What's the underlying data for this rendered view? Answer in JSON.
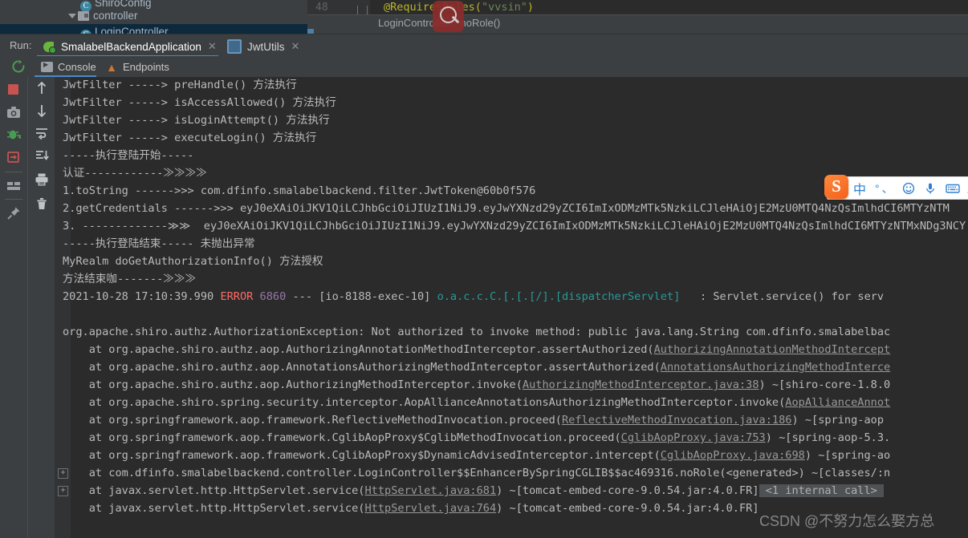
{
  "project_tree": {
    "rows": [
      {
        "label": "ShiroConfig",
        "icon": "class-icon",
        "selected": false
      },
      {
        "label": "controller",
        "icon": "folder-icon",
        "selected": false
      },
      {
        "label": "LoginController",
        "icon": "class-icon",
        "selected": true
      }
    ]
  },
  "editor": {
    "line_number": "48",
    "code_annotation": "@RequiresRoles",
    "code_paren_open": "(",
    "code_string": "\"vvsin\"",
    "code_paren_close": ")",
    "breadcrumb": {
      "class": "LoginController",
      "separator": "›",
      "method": "noRole()"
    }
  },
  "run_window": {
    "label": "Run:",
    "tabs": [
      {
        "label": "SmalabelBackendApplication",
        "icon": "spring-boot-icon",
        "close": "✕",
        "active": true
      },
      {
        "label": "JwtUtils",
        "icon": "junit-run-icon",
        "close": "✕",
        "active": false
      }
    ]
  },
  "sub_tabs": {
    "rerun_tooltip": "Rerun",
    "tabs": [
      {
        "label": "Console",
        "icon": "console-icon",
        "active": true
      },
      {
        "label": "Endpoints",
        "icon": "endpoints-icon",
        "active": false
      }
    ]
  },
  "left_toolbar_a": [
    {
      "name": "stop-button",
      "glyph": "stop"
    },
    {
      "name": "screenshot-button",
      "glyph": "camera"
    },
    {
      "name": "restart-debug-button",
      "glyph": "bug"
    },
    {
      "name": "attach-console-button",
      "glyph": "arrow-into-box"
    },
    {
      "name": "layout-button",
      "glyph": "layout"
    },
    {
      "name": "pin-button",
      "glyph": "pin"
    }
  ],
  "left_toolbar_b": [
    {
      "name": "scroll-up-button",
      "glyph": "arrow-up"
    },
    {
      "name": "scroll-down-button",
      "glyph": "arrow-down"
    },
    {
      "name": "soft-wrap-button",
      "glyph": "wrap"
    },
    {
      "name": "scroll-to-end-button",
      "glyph": "scroll-end"
    },
    {
      "name": "print-button",
      "glyph": "printer"
    },
    {
      "name": "clear-all-button",
      "glyph": "trash"
    }
  ],
  "console": {
    "lines": [
      {
        "text": "JwtFilter -----> preHandle() 方法执行"
      },
      {
        "text": "JwtFilter -----> isAccessAllowed() 方法执行"
      },
      {
        "text": "JwtFilter -----> isLoginAttempt() 方法执行"
      },
      {
        "text": "JwtFilter -----> executeLogin() 方法执行"
      },
      {
        "text": "-----执行登陆开始-----"
      },
      {
        "text": "认证------------≫≫≫≫"
      },
      {
        "text": "1.toString ------>>> com.dfinfo.smalabelbackend.filter.JwtToken@60b0f576"
      },
      {
        "text": "2.getCredentials ------>>> eyJ0eXAiOiJKV1QiLCJhbGciOiJIUzI1NiJ9.eyJwYXNzd29yZCI6ImIxODMzMTk5NzkiLCJleHAiOjE2MzU0MTQ4NzQsImlhdCI6MTYzNTM"
      },
      {
        "text": "3. -------------≫≫  eyJ0eXAiOiJKV1QiLCJhbGciOiJIUzI1NiJ9.eyJwYXNzd29yZCI6ImIxODMzMTk5NzkiLCJleHAiOjE2MzU0MTQ4NzQsImlhdCI6MTYzNTMxNDg3NCY"
      },
      {
        "text": "-----执行登陆结束----- 未抛出异常"
      },
      {
        "text": "MyRealm doGetAuthorizationInfo() 方法授权"
      },
      {
        "text": "方法结束咖-------≫≫≫"
      }
    ],
    "error_line": {
      "timestamp": "2021-10-28 17:10:39.990",
      "level": "ERROR",
      "pid": "6860",
      "dashes": "---",
      "thread": "[io-8188-exec-10]",
      "logger": "o.a.c.c.C.[.[.[/].[dispatcherServlet]",
      "colon": ":",
      "message": "Servlet.service() for serv"
    },
    "exception_header": "org.apache.shiro.authz.AuthorizationException: Not authorized to invoke method: public java.lang.String com.dfinfo.smalabelbac",
    "stack": [
      {
        "fold": false,
        "prefix": "    at org.apache.shiro.authz.aop.AuthorizingAnnotationMethodInterceptor.assertAuthorized(",
        "link": "AuthorizingAnnotationMethodIntercept",
        "suffix": ""
      },
      {
        "fold": false,
        "prefix": "    at org.apache.shiro.authz.aop.AnnotationsAuthorizingMethodInterceptor.assertAuthorized(",
        "link": "AnnotationsAuthorizingMethodInterce",
        "suffix": ""
      },
      {
        "fold": false,
        "prefix": "    at org.apache.shiro.authz.aop.AuthorizingMethodInterceptor.invoke(",
        "link": "AuthorizingMethodInterceptor.java:38",
        "suffix": ") ~[shiro-core-1.8.0"
      },
      {
        "fold": false,
        "prefix": "    at org.apache.shiro.spring.security.interceptor.AopAllianceAnnotationsAuthorizingMethodInterceptor.invoke(",
        "link": "AopAllianceAnnot",
        "suffix": ""
      },
      {
        "fold": false,
        "prefix": "    at org.springframework.aop.framework.ReflectiveMethodInvocation.proceed(",
        "link": "ReflectiveMethodInvocation.java:186",
        "suffix": ") ~[spring-aop"
      },
      {
        "fold": false,
        "prefix": "    at org.springframework.aop.framework.CglibAopProxy$CglibMethodInvocation.proceed(",
        "link": "CglibAopProxy.java:753",
        "suffix": ") ~[spring-aop-5.3."
      },
      {
        "fold": false,
        "prefix": "    at org.springframework.aop.framework.CglibAopProxy$DynamicAdvisedInterceptor.intercept(",
        "link": "CglibAopProxy.java:698",
        "suffix": ") ~[spring-ao"
      },
      {
        "fold": true,
        "prefix": "    at com.dfinfo.smalabelbackend.controller.LoginController$$EnhancerBySpringCGLIB$$ac469316.noRole(<generated>) ~[classes/:n",
        "link": "",
        "suffix": ""
      },
      {
        "fold": true,
        "prefix": "    at javax.servlet.http.HttpServlet.service(",
        "link": "HttpServlet.java:681",
        "suffix": ") ~[tomcat-embed-core-9.0.54.jar:4.0.FR]",
        "internal": " <1 internal call> "
      },
      {
        "fold": false,
        "prefix": "    at javax.servlet.http.HttpServlet.service(",
        "link": "HttpServlet.java:764",
        "suffix": ") ~[tomcat-embed-core-9.0.54.jar:4.0.FR]"
      }
    ]
  },
  "ime_bar": {
    "logo": "S",
    "mode": "中",
    "punct_full": "°",
    "punct_cn": "、",
    "emoji_icon": "☺",
    "mic_icon": "mic",
    "keyboard_icon": "keyboard",
    "user_icon": "user"
  },
  "watermark": "CSDN @不努力怎么娶方总",
  "colors": {
    "ide_chrome": "#3c3f41",
    "console_bg": "#2b2b2b",
    "accent_blue": "#4a88c7",
    "error_red": "#ff6b68",
    "logger_teal": "#299999",
    "number_purple": "#9876aa",
    "selection_blue": "#0d293e"
  }
}
